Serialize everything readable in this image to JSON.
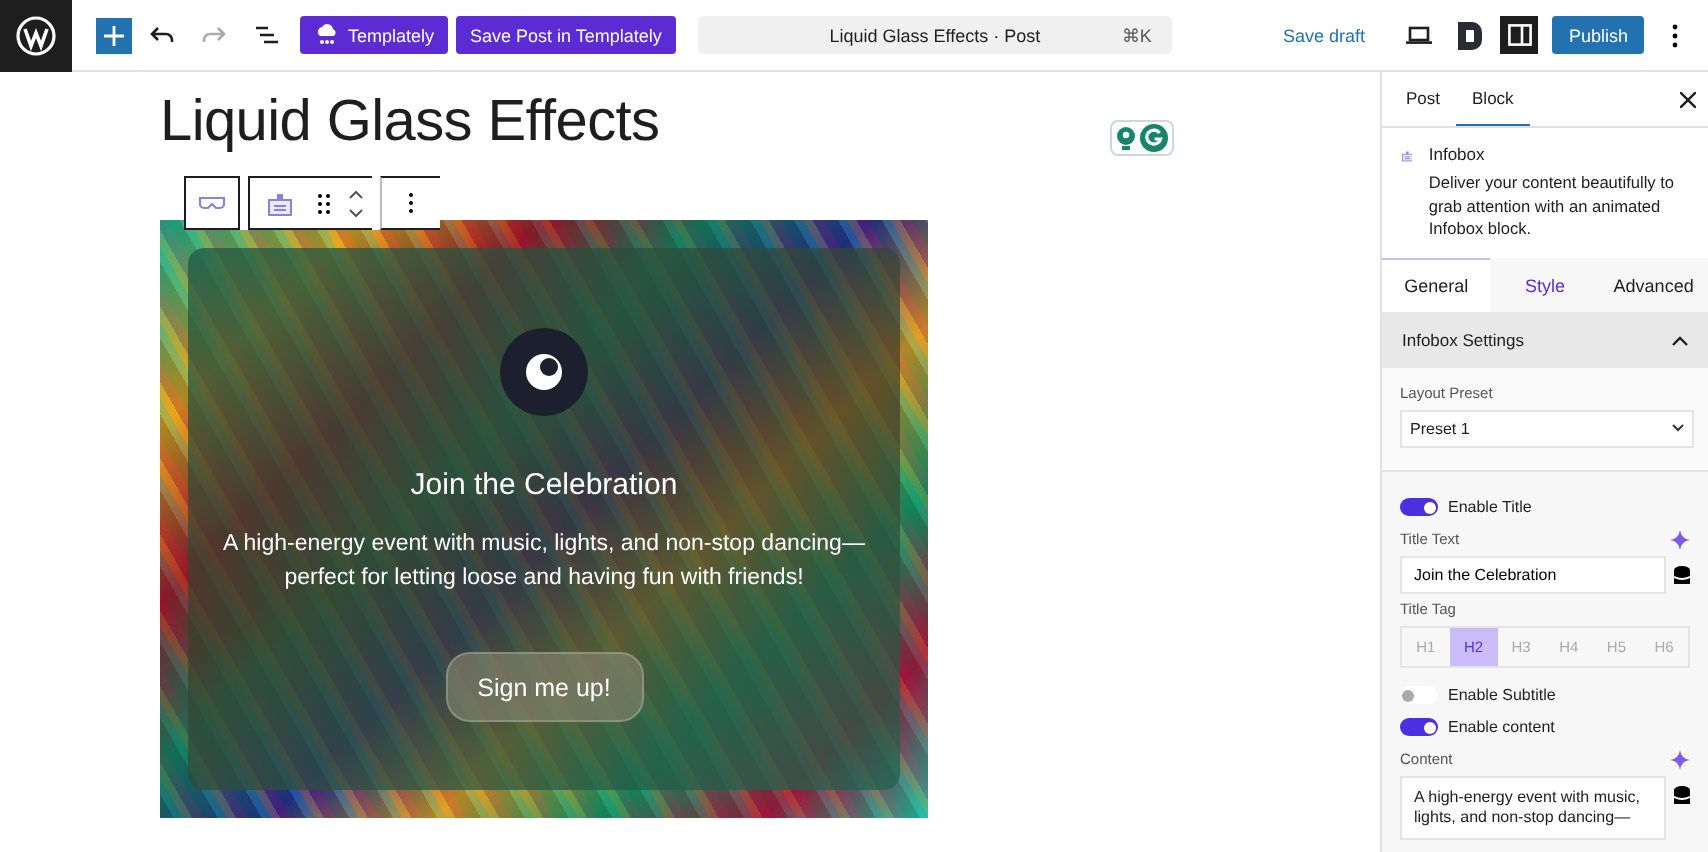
{
  "toolbar": {
    "undo_disabled": false,
    "redo_disabled": true,
    "templately": "Templately",
    "save_templately": "Save Post in Templately"
  },
  "command_bar": {
    "title": "Liquid Glass Effects · Post",
    "shortcut": "⌘K"
  },
  "save_draft": "Save draft",
  "sidebar_toggle_pressed": true,
  "publish": "Publish",
  "post_title": "Liquid Glass Effects",
  "infobox": {
    "title": "Join the Celebration",
    "content": "A high-energy event with music, lights, and non-stop dancing—perfect for letting loose and having fun with friends!",
    "button": "Sign me up!"
  },
  "sidebar": {
    "tabs": [
      {
        "label": "Post",
        "selected": false
      },
      {
        "label": "Block",
        "selected": true
      }
    ],
    "block": {
      "name": "Infobox",
      "description": "Deliver your content beautifully to grab attention with an animated Infobox block."
    },
    "panel_tabs": [
      {
        "label": "General",
        "selected": true,
        "hovered": false
      },
      {
        "label": "Style",
        "selected": false,
        "hovered": true
      },
      {
        "label": "Advanced",
        "selected": false,
        "hovered": false
      }
    ],
    "section": {
      "title": "Infobox Settings",
      "expanded": true
    },
    "fields": [
      {
        "kind": "select",
        "label": "Layout Preset",
        "value": "Preset 1"
      },
      {
        "kind": "toggle",
        "label": "Enable Title",
        "on": true
      },
      {
        "kind": "text",
        "label": "Title Text",
        "value": "Join the Celebration"
      },
      {
        "kind": "tags",
        "label": "Title Tag",
        "options": [
          {
            "label": "H1",
            "selected": false
          },
          {
            "label": "H2",
            "selected": true
          },
          {
            "label": "H3",
            "selected": false
          },
          {
            "label": "H4",
            "selected": false
          },
          {
            "label": "H5",
            "selected": false
          },
          {
            "label": "H6",
            "selected": false
          }
        ]
      },
      {
        "kind": "toggle",
        "label": "Enable Subtitle",
        "on": false
      },
      {
        "kind": "toggle",
        "label": "Enable content",
        "on": true
      },
      {
        "kind": "textarea",
        "label": "Content",
        "value": "A high-energy event with music, lights, and non-stop dancing—"
      }
    ]
  }
}
